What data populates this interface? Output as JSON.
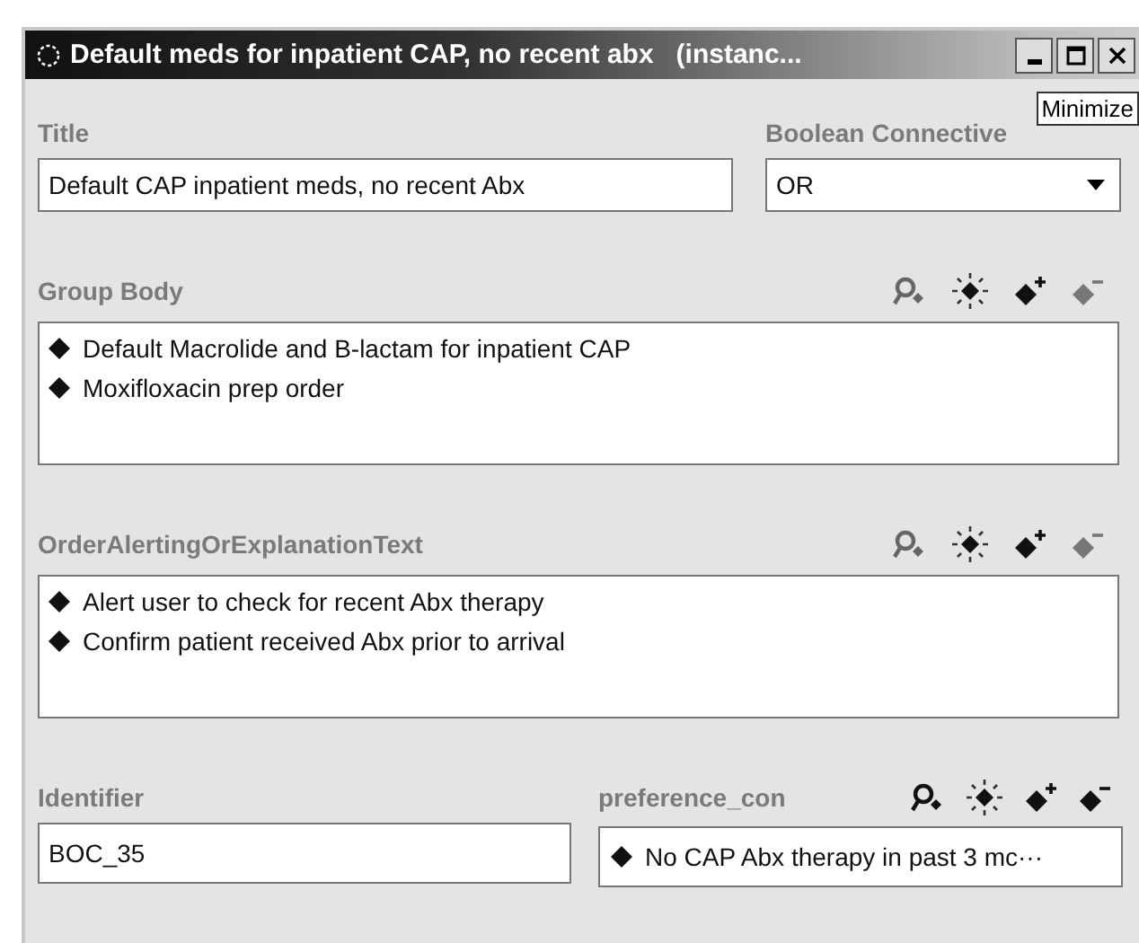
{
  "window": {
    "title": "Default meds for inpatient CAP, no recent abx   (instanc...",
    "tooltip": "Minimize"
  },
  "title_field": {
    "label": "Title",
    "value": "Default CAP inpatient meds, no recent Abx"
  },
  "boolean_connective": {
    "label": "Boolean Connective",
    "value": "OR"
  },
  "group_body": {
    "label": "Group Body",
    "items": [
      "Default Macrolide and B-lactam for inpatient CAP",
      "Moxifloxacin prep order"
    ]
  },
  "order_alerting": {
    "label": "OrderAlertingOrExplanationText",
    "items": [
      "Alert user to check for recent Abx therapy",
      "Confirm patient received Abx prior to arrival"
    ]
  },
  "identifier": {
    "label": "Identifier",
    "value": "BOC_35"
  },
  "preference": {
    "label": "preference_con",
    "items": [
      "No CAP Abx therapy in past 3 mc···"
    ]
  }
}
